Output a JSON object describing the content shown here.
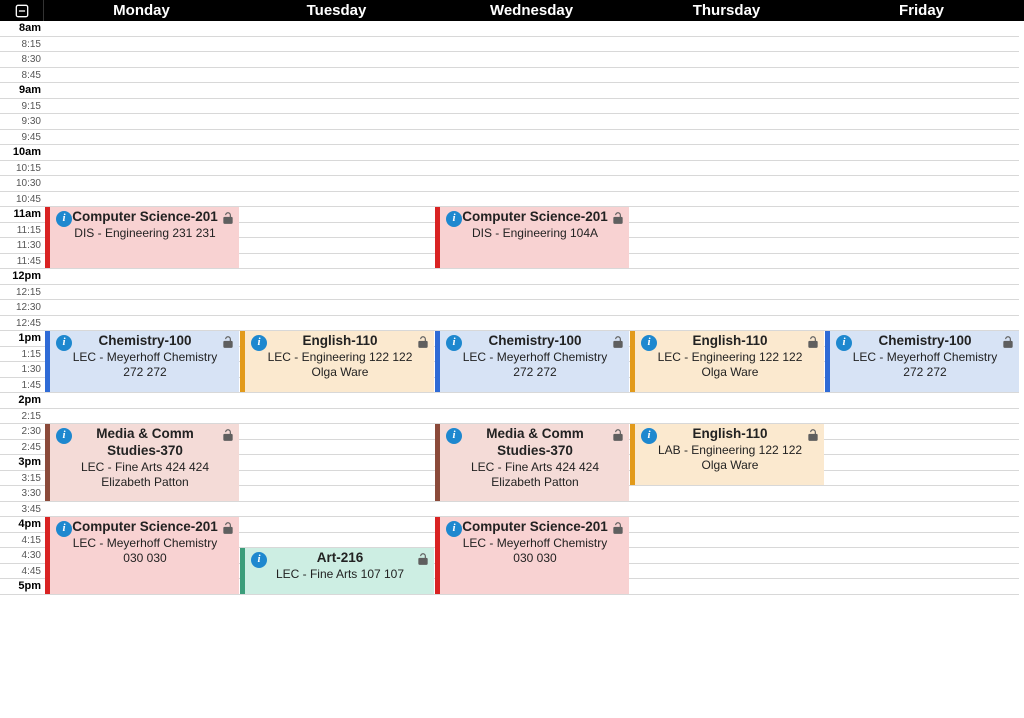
{
  "collapse_icon": "collapse-icon",
  "days": [
    "Monday",
    "Tuesday",
    "Wednesday",
    "Thursday",
    "Friday"
  ],
  "grid_start_slot": 0,
  "time_slots": [
    {
      "label": "8am",
      "hour": true
    },
    {
      "label": "8:15"
    },
    {
      "label": "8:30"
    },
    {
      "label": "8:45"
    },
    {
      "label": "9am",
      "hour": true
    },
    {
      "label": "9:15"
    },
    {
      "label": "9:30"
    },
    {
      "label": "9:45"
    },
    {
      "label": "10am",
      "hour": true
    },
    {
      "label": "10:15"
    },
    {
      "label": "10:30"
    },
    {
      "label": "10:45"
    },
    {
      "label": "11am",
      "hour": true
    },
    {
      "label": "11:15"
    },
    {
      "label": "11:30"
    },
    {
      "label": "11:45"
    },
    {
      "label": "12pm",
      "hour": true
    },
    {
      "label": "12:15"
    },
    {
      "label": "12:30"
    },
    {
      "label": "12:45"
    },
    {
      "label": "1pm",
      "hour": true
    },
    {
      "label": "1:15"
    },
    {
      "label": "1:30"
    },
    {
      "label": "1:45"
    },
    {
      "label": "2pm",
      "hour": true
    },
    {
      "label": "2:15"
    },
    {
      "label": "2:30"
    },
    {
      "label": "2:45"
    },
    {
      "label": "3pm",
      "hour": true
    },
    {
      "label": "3:15"
    },
    {
      "label": "3:30"
    },
    {
      "label": "3:45"
    },
    {
      "label": "4pm",
      "hour": true
    },
    {
      "label": "4:15"
    },
    {
      "label": "4:30"
    },
    {
      "label": "4:45"
    },
    {
      "label": "5pm",
      "hour": true
    }
  ],
  "events": [
    {
      "day": 0,
      "start": 12,
      "span": 4,
      "color": "red",
      "title": "Computer Science-201",
      "sub": "DIS - Engineering 231 231"
    },
    {
      "day": 0,
      "start": 20,
      "span": 4,
      "color": "blue",
      "title": "Chemistry-100",
      "sub": "LEC - Meyerhoff Chemistry 272 272"
    },
    {
      "day": 0,
      "start": 26,
      "span": 5,
      "color": "brown",
      "title": "Media & Comm Studies-370",
      "sub": "LEC - Fine Arts 424 424",
      "instr": "Elizabeth Patton"
    },
    {
      "day": 0,
      "start": 32,
      "span": 5,
      "color": "red",
      "title": "Computer Science-201",
      "sub": "LEC - Meyerhoff Chemistry 030 030"
    },
    {
      "day": 1,
      "start": 20,
      "span": 4,
      "color": "orange",
      "title": "English-110",
      "sub": "LEC - Engineering 122 122",
      "instr": "Olga Ware"
    },
    {
      "day": 1,
      "start": 34,
      "span": 3,
      "color": "green",
      "title": "Art-216",
      "sub": "LEC - Fine Arts 107 107"
    },
    {
      "day": 2,
      "start": 12,
      "span": 4,
      "color": "red",
      "title": "Computer Science-201",
      "sub": "DIS - Engineering 104A"
    },
    {
      "day": 2,
      "start": 20,
      "span": 4,
      "color": "blue",
      "title": "Chemistry-100",
      "sub": "LEC - Meyerhoff Chemistry 272 272"
    },
    {
      "day": 2,
      "start": 26,
      "span": 5,
      "color": "brown",
      "title": "Media & Comm Studies-370",
      "sub": "LEC - Fine Arts 424 424",
      "instr": "Elizabeth Patton"
    },
    {
      "day": 2,
      "start": 32,
      "span": 5,
      "color": "red",
      "title": "Computer Science-201",
      "sub": "LEC - Meyerhoff Chemistry 030 030"
    },
    {
      "day": 3,
      "start": 20,
      "span": 4,
      "color": "orange",
      "title": "English-110",
      "sub": "LEC - Engineering 122 122",
      "instr": "Olga Ware"
    },
    {
      "day": 3,
      "start": 26,
      "span": 4,
      "color": "orange",
      "title": "English-110",
      "sub": "LAB - Engineering 122 122",
      "instr": "Olga Ware"
    },
    {
      "day": 4,
      "start": 20,
      "span": 4,
      "color": "blue",
      "title": "Chemistry-100",
      "sub": "LEC - Meyerhoff Chemistry 272 272"
    }
  ],
  "colors": {
    "red": "#f8d2d2",
    "blue": "#d7e3f5",
    "orange": "#fbe9cf",
    "brown": "#f4dbd7",
    "green": "#cdeee3"
  }
}
